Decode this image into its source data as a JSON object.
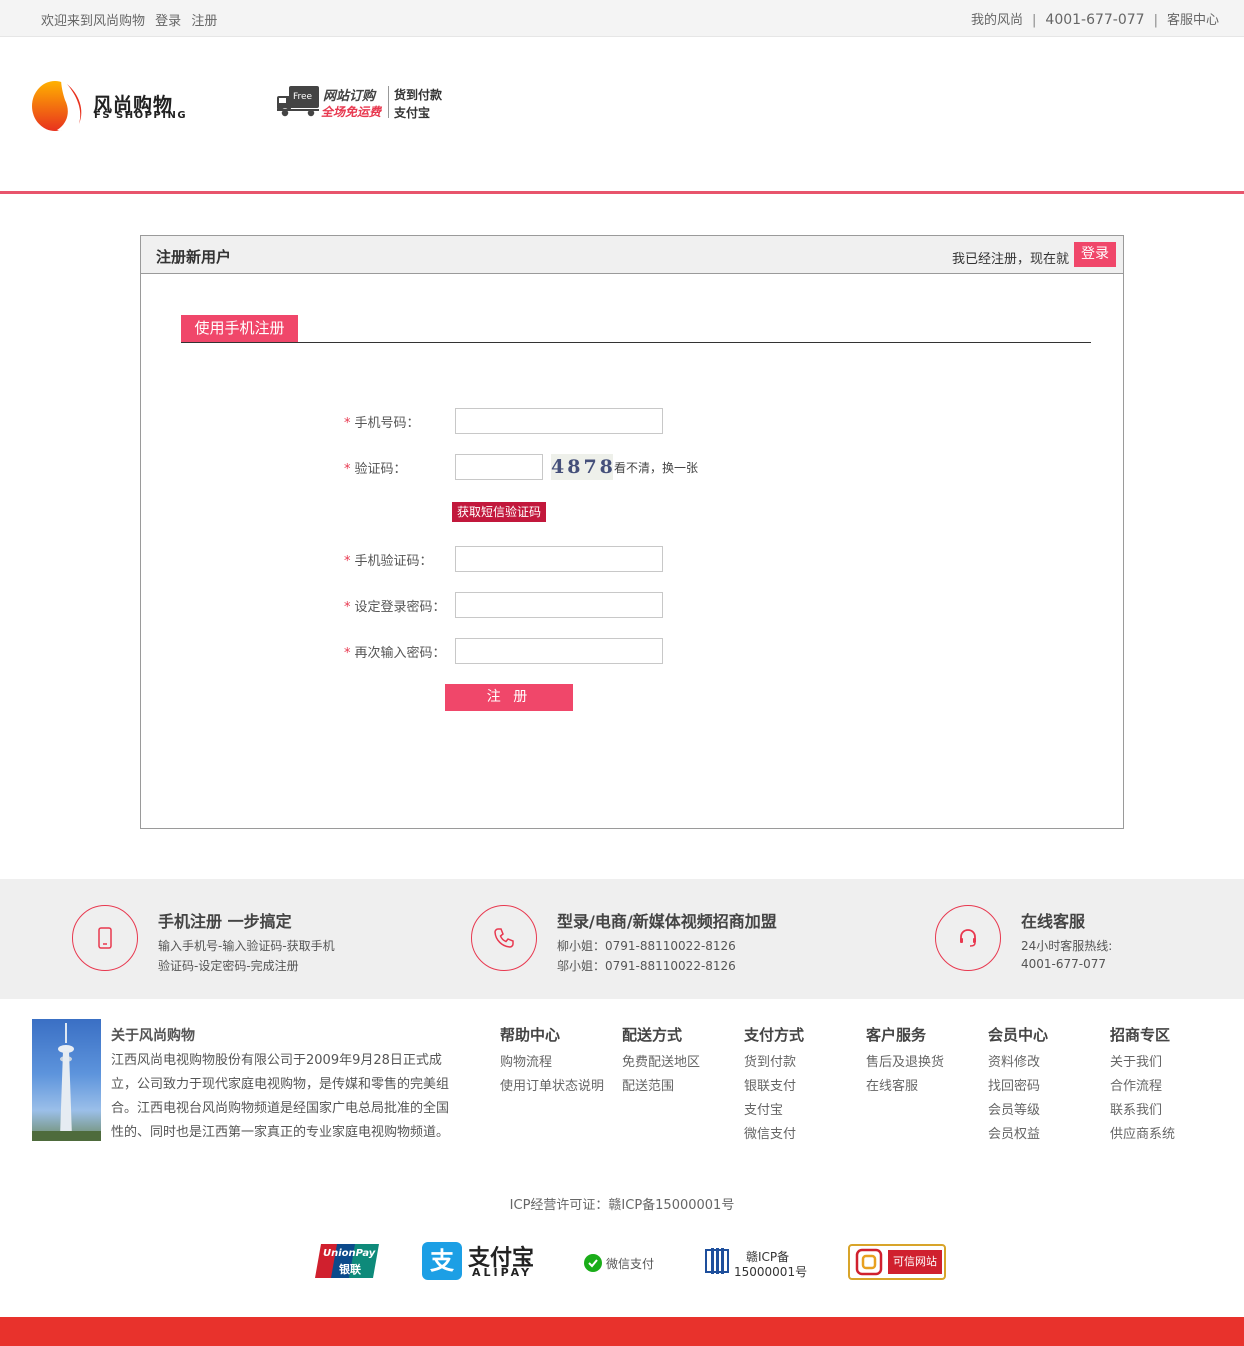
{
  "topbar": {
    "welcome": "欢迎来到风尚购物",
    "login": "登录",
    "register": "注册",
    "my_account": "我的风尚",
    "phone": "4001-677-077",
    "service": "客服中心",
    "sep": "|"
  },
  "header": {
    "logo_cn": "风尚购物",
    "logo_en": "FS SHOPPING",
    "free_badge": "Free",
    "promo_order": "网站订购",
    "promo_free_shipping": "全场免运费",
    "promo_cod": "货到付款",
    "promo_alipay": "支付宝"
  },
  "register": {
    "title": "注册新用户",
    "already": "我已经注册，现在就",
    "login_btn": "登录",
    "tab": "使用手机注册",
    "star": "*",
    "fields": {
      "phone": "手机号码：",
      "captcha": "验证码：",
      "sms_code": "手机验证码：",
      "password": "设定登录密码：",
      "password_again": "再次输入密码："
    },
    "captcha_value": "4878",
    "refresh": "看不清，换一张",
    "sms_btn": "获取短信验证码",
    "submit": "注 册"
  },
  "features": [
    {
      "title": "手机注册  一步搞定",
      "line1": "输入手机号-输入验证码-获取手机",
      "line2": "验证码-设定密码-完成注册",
      "icon": "mobile-icon"
    },
    {
      "title": "型录/电商/新媒体视频招商加盟",
      "line1": "柳小姐：0791-88110022-8126",
      "line2": "邬小姐：0791-88110022-8126",
      "icon": "phone-icon"
    },
    {
      "title": "在线客服",
      "line1": "24小时客服热线:",
      "line2": "4001-677-077",
      "icon": "headset-icon"
    }
  ],
  "footer": {
    "about_title": "关于风尚购物",
    "about_text": "江西风尚电视购物股份有限公司于2009年9月28日正式成立，公司致力于现代家庭电视购物，是传媒和零售的完美组合。江西电视台风尚购物频道是经国家广电总局批准的全国性的、同时也是江西第一家真正的专业家庭电视购物频道。",
    "columns": [
      {
        "title": "帮助中心",
        "items": [
          "购物流程",
          "使用订单状态说明"
        ]
      },
      {
        "title": "配送方式",
        "items": [
          "免费配送地区",
          "配送范围"
        ]
      },
      {
        "title": "支付方式",
        "items": [
          "货到付款",
          "银联支付",
          "支付宝",
          "微信支付"
        ]
      },
      {
        "title": "客户服务",
        "items": [
          "售后及退换货",
          "在线客服"
        ]
      },
      {
        "title": "会员中心",
        "items": [
          "资料修改",
          "找回密码",
          "会员等级",
          "会员权益"
        ]
      },
      {
        "title": "招商专区",
        "items": [
          "关于我们",
          "合作流程",
          "联系我们",
          "供应商系统"
        ]
      }
    ],
    "icp": "ICP经营许可证：赣ICP备15000001号",
    "badges": {
      "unionpay_en": "UnionPay",
      "unionpay_cn": "银联",
      "alipay_cn": "支付宝",
      "alipay_en": "ALIPAY",
      "alipay_char": "支",
      "wechat": "微信支付",
      "icp_line1": "赣ICP备",
      "icp_line2": "15000001号",
      "trusted": "可信网站"
    }
  }
}
